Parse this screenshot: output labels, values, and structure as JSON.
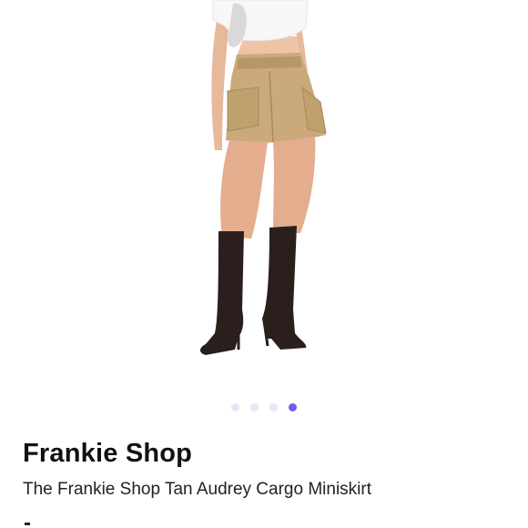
{
  "product": {
    "brand": "Frankie Shop",
    "title": "The Frankie Shop Tan Audrey Cargo Miniskirt"
  },
  "carousel": {
    "slide_count": 4,
    "active_index": 3
  },
  "colors": {
    "dot_inactive": "#e3e8f6",
    "dot_active": "#6e5cf0",
    "skirt_tan": "#caa97a"
  }
}
